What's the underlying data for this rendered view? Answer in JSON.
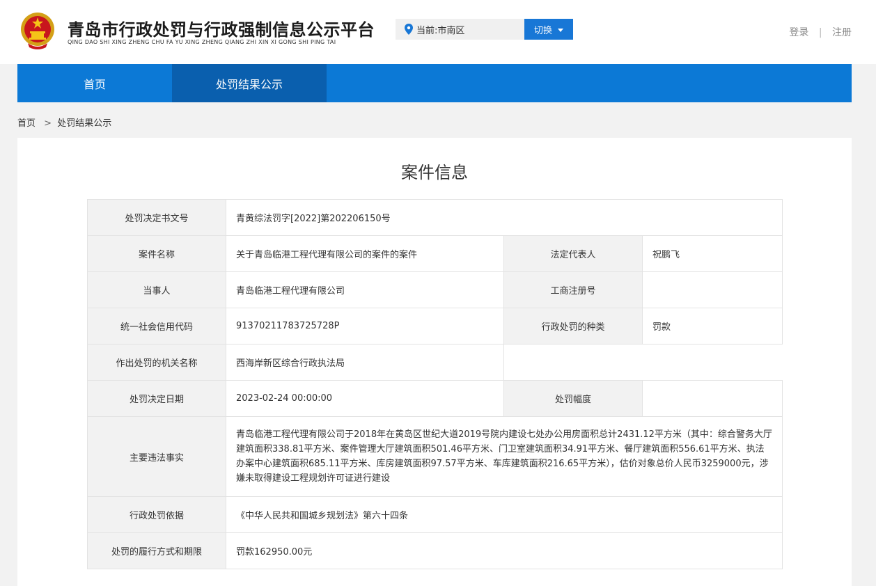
{
  "header": {
    "title": "青岛市行政处罚与行政强制信息公示平台",
    "pinyin": "QING DAO SHI XING ZHENG CHU FA YU XING ZHENG QIANG ZHI XIN XI GONG SHI PING TAI",
    "region": "当前:市南区",
    "switch_label": "切换",
    "login": "登录",
    "separator": "|",
    "register": "注册"
  },
  "nav": {
    "items": [
      {
        "label": "首页"
      },
      {
        "label": "处罚结果公示"
      }
    ],
    "active_index": 1
  },
  "breadcrumb": {
    "home": "首页",
    "arrow": ">",
    "current": "处罚结果公示"
  },
  "case": {
    "title": "案件信息",
    "doc_no_label": "处罚决定书文号",
    "doc_no": "青黄综法罚字[2022]第202206150号",
    "case_name_label": "案件名称",
    "case_name": "关于青岛临港工程代理有限公司的案件的案件",
    "legal_rep_label": "法定代表人",
    "legal_rep": "祝鹏飞",
    "party_label": "当事人",
    "party": "青岛临港工程代理有限公司",
    "reg_no_label": "工商注册号",
    "reg_no": "",
    "credit_code_label": "统一社会信用代码",
    "credit_code": "91370211783725728P",
    "penalty_type_label": "行政处罚的种类",
    "penalty_type": "罚款",
    "authority_label": "作出处罚的机关名称",
    "authority": "西海岸新区综合行政执法局",
    "decision_date_label": "处罚决定日期",
    "decision_date": "2023-02-24 00:00:00",
    "range_label": "处罚幅度",
    "range": "",
    "facts_label": "主要违法事实",
    "facts": "青岛临港工程代理有限公司于2018年在黄岛区世纪大道2019号院内建设七处办公用房面积总计2431.12平方米（其中：综合警务大厅建筑面积338.81平方米、案件管理大厅建筑面积501.46平方米、门卫室建筑面积34.91平方米、餐厅建筑面积556.61平方米、执法办案中心建筑面积685.11平方米、库房建筑面积97.57平方米、车库建筑面积216.65平方米），估价对象总价人民币3259000元，涉嫌未取得建设工程规划许可证进行建设",
    "basis_label": "行政处罚依据",
    "basis": "《中华人民共和国城乡规划法》第六十四条",
    "execution_label": "处罚的履行方式和期限",
    "execution": "罚款162950.00元"
  },
  "icons": {
    "emblem": "national-emblem-icon",
    "pin": "location-pin-icon",
    "caret": "caret-down-icon"
  },
  "colors": {
    "primary_blue": "#0c79d6",
    "active_nav": "#0a5fae",
    "button_blue": "#1877d6",
    "label_bg": "#f2f2f2"
  }
}
